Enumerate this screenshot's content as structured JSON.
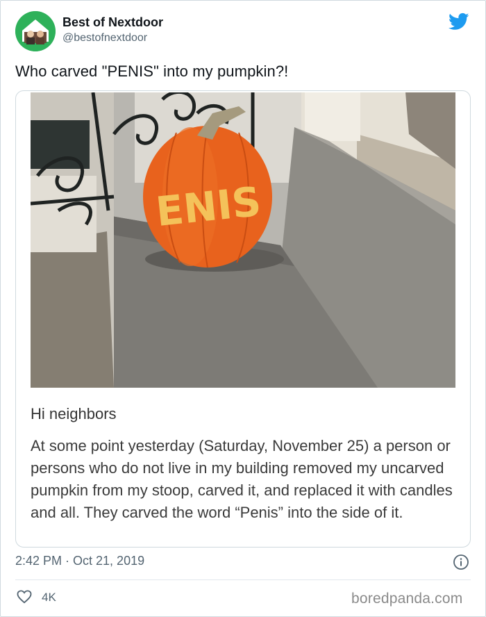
{
  "account": {
    "name": "Best of Nextdoor",
    "handle": "@bestofnextdoor"
  },
  "tweet": {
    "text": "Who carved \"PENIS\" into my pumpkin?!"
  },
  "embedded_post": {
    "greeting": "Hi neighbors",
    "body": "At some point yesterday (Saturday, November 25) a person or persons who do not live in my building removed my uncarved pumpkin from my stoop, carved it, and replaced it with candles and all. They carved the word “Penis” into the side of it.",
    "pumpkin_carving": "ENIS"
  },
  "meta": {
    "timestamp": "2:42 PM · Oct 21, 2019"
  },
  "footer": {
    "likes": "4K",
    "watermark": "boredpanda.com"
  },
  "icons": {
    "platform": "twitter-bird-icon",
    "info": "info-icon",
    "like": "heart-icon"
  },
  "colors": {
    "twitter_blue": "#1d9bf0",
    "avatar_green": "#2eb15a",
    "pumpkin_orange": "#e8621d",
    "muted_text": "#536471"
  }
}
